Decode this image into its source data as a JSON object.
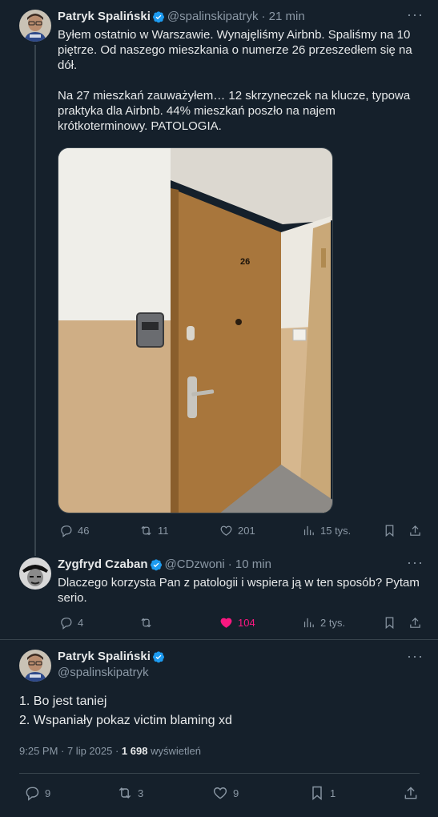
{
  "tweet1": {
    "name": "Patryk Spaliński",
    "handle": "@spalinskipatryk",
    "time": "· 21 min",
    "text": "Byłem ostatnio w Warszawie. Wynajęliśmy Airbnb. Spaliśmy na 10 piętrze. Od naszego mieszkania o numerze 26 przeszedłem się na dół.\n\nNa 27 mieszkań zauważyłem… 12 skrzyneczek na klucze, typowa praktyka dla Airbnb. 44% mieszkań poszło na najem krótkoterminowy. PATOLOGIA.",
    "door_number": "26",
    "stats": {
      "replies": "46",
      "retweets": "11",
      "likes": "201",
      "views": "15 tys."
    }
  },
  "tweet2": {
    "name": "Zygfryd Czaban",
    "handle": "@CDzwoni",
    "time": "· 10 min",
    "text": "Dlaczego korzysta Pan z patologii i wspiera ją w ten sposób? Pytam serio.",
    "stats": {
      "replies": "4",
      "retweets": "",
      "likes": "104",
      "views": "2 tys."
    }
  },
  "main": {
    "name": "Patryk Spaliński",
    "handle": "@spalinskipatryk",
    "text": "1. Bo jest taniej\n2. Wspaniały pokaz victim blaming xd",
    "timestamp": "9:25 PM · 7 lip 2025 · ",
    "views_count": "1 698",
    "views_label": " wyświetleń",
    "stats": {
      "replies": "9",
      "retweets": "3",
      "likes": "9",
      "bookmarks": "1"
    }
  },
  "more_label": "···",
  "colors": {
    "background": "#15202b",
    "accent_verified": "#1d9bf0",
    "like_pink": "#f91880",
    "muted": "#8b98a5",
    "divider": "#38444d"
  }
}
